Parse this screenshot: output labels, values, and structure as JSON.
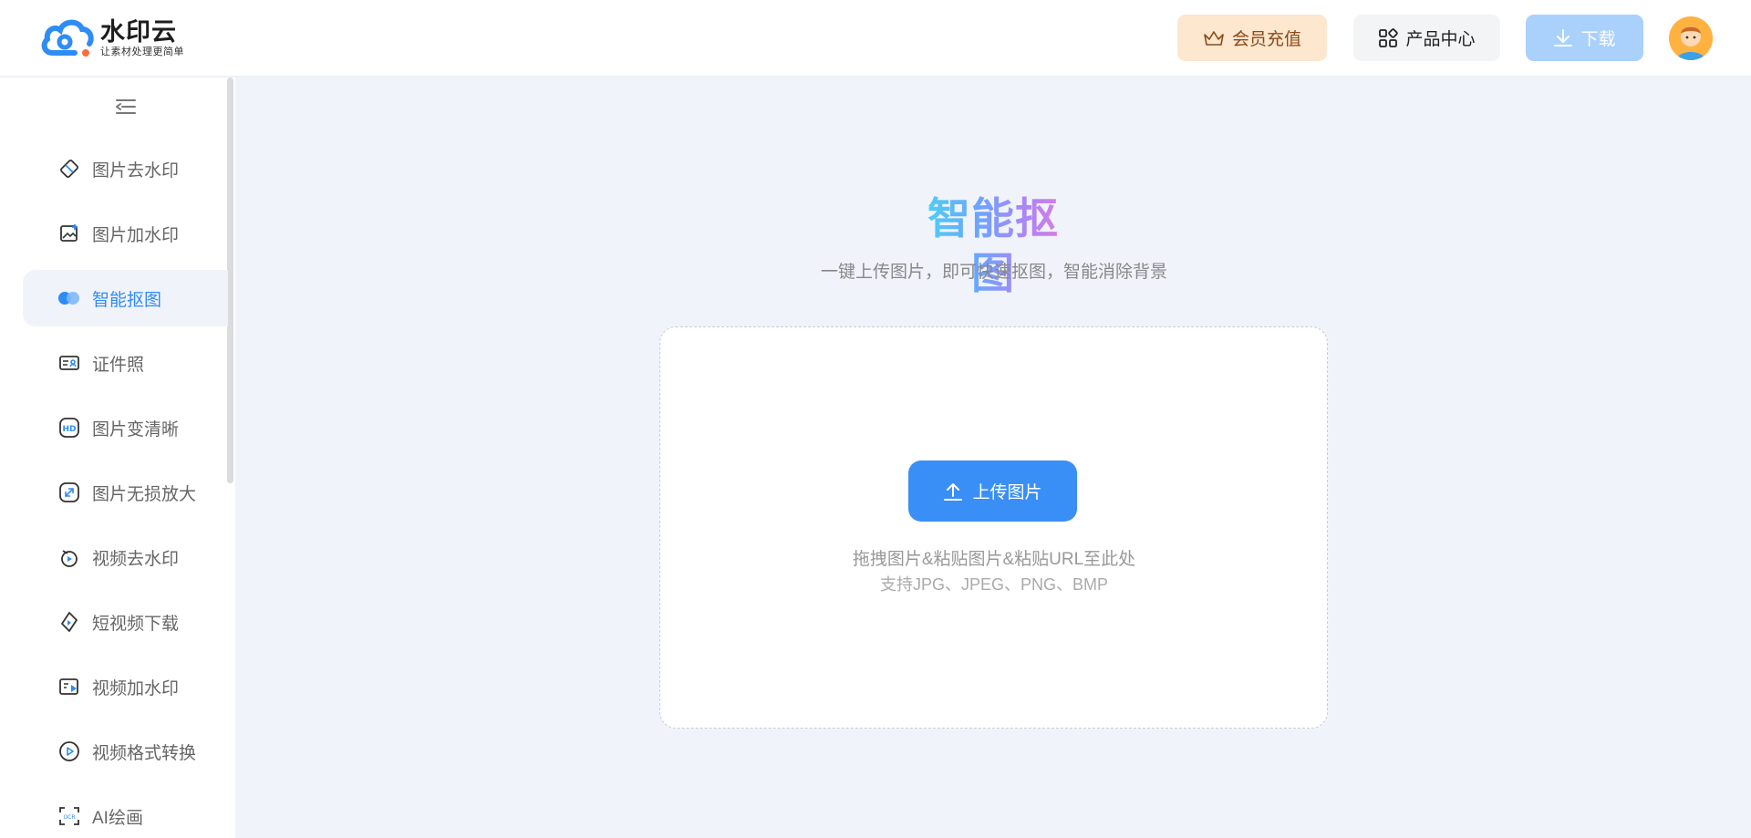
{
  "header": {
    "logo_name": "水印云",
    "logo_slogan": "让素材处理更简单",
    "vip_label": "会员充值",
    "products_label": "产品中心",
    "download_label": "下载"
  },
  "sidebar": {
    "items": [
      {
        "label": "图片去水印",
        "icon": "eraser-icon"
      },
      {
        "label": "图片加水印",
        "icon": "image-add-icon"
      },
      {
        "label": "智能抠图",
        "icon": "matting-icon",
        "active": true
      },
      {
        "label": "证件照",
        "icon": "id-card-icon"
      },
      {
        "label": "图片变清晰",
        "icon": "hd-icon"
      },
      {
        "label": "图片无损放大",
        "icon": "enlarge-icon"
      },
      {
        "label": "视频去水印",
        "icon": "video-eraser-icon"
      },
      {
        "label": "短视频下载",
        "icon": "short-video-download-icon"
      },
      {
        "label": "视频加水印",
        "icon": "video-add-icon"
      },
      {
        "label": "视频格式转换",
        "icon": "video-convert-icon"
      },
      {
        "label": "AI绘画",
        "icon": "ai-paint-icon"
      }
    ]
  },
  "main": {
    "title": "智能抠图",
    "subtitle": "一键上传图片，即可快速抠图，智能消除背景",
    "upload_label": "上传图片",
    "hint_line1": "拖拽图片&粘贴图片&粘贴URL至此处",
    "hint_line2": "支持JPG、JPEG、PNG、BMP"
  },
  "colors": {
    "accent": "#3a8ff6",
    "vip_bg": "#fde7cf",
    "download_bg": "#a9d1fc",
    "page_bg": "#f0f3fa"
  }
}
